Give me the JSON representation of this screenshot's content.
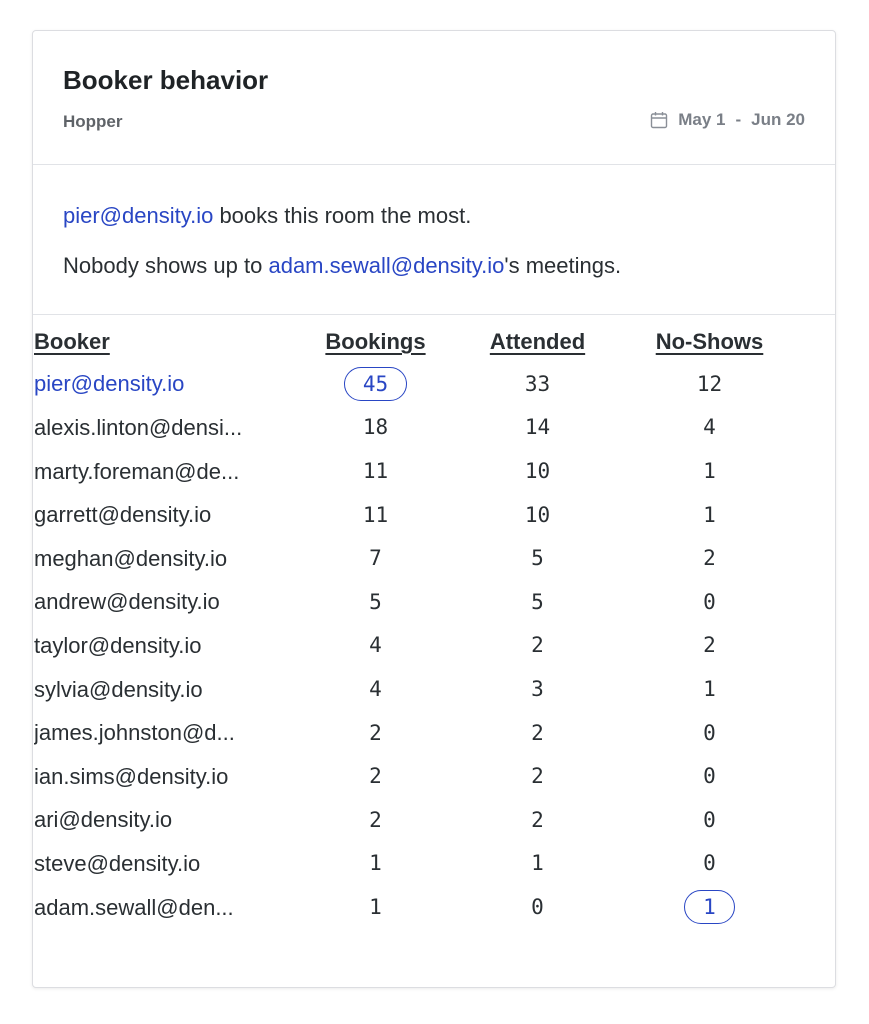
{
  "card": {
    "title": "Booker behavior",
    "room": "Hopper",
    "date_start": "May 1",
    "date_separator": "-",
    "date_end": "Jun 20",
    "icons": {
      "date": "calendar-icon"
    }
  },
  "summary": {
    "most_bookings_email": "pier@density.io",
    "most_bookings_text": " books this room the most.",
    "no_show_prefix": "Nobody shows up to ",
    "no_show_email": "adam.sewall@density.io",
    "no_show_suffix": "'s meetings."
  },
  "colors": {
    "accent": "#2946c4",
    "text": "#2a2f33",
    "muted": "#7a7f87"
  },
  "table": {
    "headers": {
      "booker": "Booker",
      "bookings": "Bookings",
      "attended": "Attended",
      "no_shows": "No-Shows"
    },
    "rows": [
      {
        "booker": "pier@density.io",
        "bookings": "45",
        "attended": "33",
        "no_shows": "12"
      },
      {
        "booker": "alexis.linton@densi...",
        "bookings": "18",
        "attended": "14",
        "no_shows": "4"
      },
      {
        "booker": "marty.foreman@de...",
        "bookings": "11",
        "attended": "10",
        "no_shows": "1"
      },
      {
        "booker": "garrett@density.io",
        "bookings": "11",
        "attended": "10",
        "no_shows": "1"
      },
      {
        "booker": "meghan@density.io",
        "bookings": "7",
        "attended": "5",
        "no_shows": "2"
      },
      {
        "booker": "andrew@density.io",
        "bookings": "5",
        "attended": "5",
        "no_shows": "0"
      },
      {
        "booker": "taylor@density.io",
        "bookings": "4",
        "attended": "2",
        "no_shows": "2"
      },
      {
        "booker": "sylvia@density.io",
        "bookings": "4",
        "attended": "3",
        "no_shows": "1"
      },
      {
        "booker": "james.johnston@d...",
        "bookings": "2",
        "attended": "2",
        "no_shows": "0"
      },
      {
        "booker": "ian.sims@density.io",
        "bookings": "2",
        "attended": "2",
        "no_shows": "0"
      },
      {
        "booker": "ari@density.io",
        "bookings": "2",
        "attended": "2",
        "no_shows": "0"
      },
      {
        "booker": "steve@density.io",
        "bookings": "1",
        "attended": "1",
        "no_shows": "0"
      },
      {
        "booker": "adam.sewall@den...",
        "bookings": "1",
        "attended": "0",
        "no_shows": "1"
      }
    ]
  }
}
